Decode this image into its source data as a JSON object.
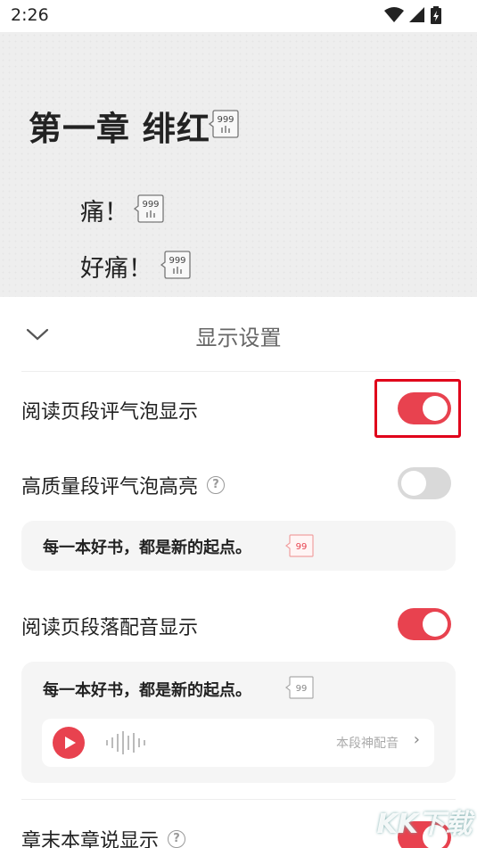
{
  "status_bar": {
    "time": "2:26"
  },
  "reader": {
    "chapter_title": "第一章 绯红",
    "paragraphs": [
      "痛！",
      "好痛！"
    ],
    "bubble_count": "999"
  },
  "panel": {
    "title": "显示设置",
    "settings": [
      {
        "label": "阅读页段评气泡显示",
        "state": "on"
      },
      {
        "label": "高质量段评气泡高亮",
        "state": "off",
        "has_help": true
      },
      {
        "label": "阅读页段落配音显示",
        "state": "on"
      },
      {
        "label": "章末本章说显示",
        "state": "on",
        "has_help": true
      }
    ],
    "help_glyph": "?",
    "preview_1": {
      "text": "每一本好书，都是新的起点。",
      "bubble_count": "99"
    },
    "preview_2": {
      "text": "每一本好书，都是新的起点。",
      "bubble_count": "99",
      "dub_label": "本段神配音",
      "dub_arrow": "›"
    }
  },
  "watermark": "KK下载",
  "colors": {
    "accent": "#e8424f",
    "highlight": "#e0001a",
    "toggle_off": "#d9d9d9",
    "card_bg": "#f5f5f5"
  }
}
